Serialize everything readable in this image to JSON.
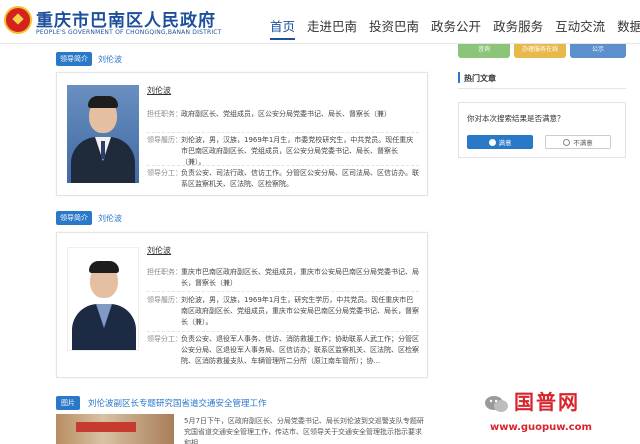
{
  "header": {
    "site_title": "重庆市巴南区人民政府",
    "site_subtitle": "PEOPLE'S GOVERNMENT OF CHONGQING,BANAN DISTRICT",
    "nav": [
      "首页",
      "走进巴南",
      "投资巴南",
      "政务公开",
      "政务服务",
      "互动交流",
      "数据发布"
    ],
    "active_nav_index": 0
  },
  "leaders": [
    {
      "tag": "领导简介",
      "name": "刘伦波",
      "fields": [
        {
          "label": "担任职务：",
          "value": "政府副区长、党组成员，区公安分局党委书记、局长、督察长（兼）"
        },
        {
          "label": "领导履历：",
          "value": "刘伦波，男，汉族，1969年1月生，市委党校研究生，中共党员。现任重庆市巴南区政府副区长、党组成员，区公安分局党委书记、局长、督察长（兼）。"
        },
        {
          "label": "领导分工：",
          "value": "负责公安、司法行政、信访工作。分管区公安分局、区司法局、区信访办。联系区监察机关、区法院、区检察院。"
        }
      ]
    },
    {
      "tag": "领导简介",
      "name": "刘伦波",
      "fields": [
        {
          "label": "担任职务：",
          "value": "重庆市巴南区政府副区长、党组成员，重庆市公安局巴南区分局党委书记、局长，督察长（兼）"
        },
        {
          "label": "领导履历：",
          "value": "刘伦波，男，汉族，1969年1月生，研究生学历，中共党员。现任重庆市巴南区政府副区长、党组成员，重庆市公安局巴南区分局党委书记、局长，督察长（兼）。"
        },
        {
          "label": "领导分工：",
          "value": "负责公安、退役军人事务、信访、消防救援工作；协助联系人武工作；分管区公安分局、区退役军人事务局、区信访办；联系区监察机关、区法院、区检察院、区消防救援支队、车辆管理所二分所（原江南车管所）；协..."
        }
      ]
    }
  ],
  "news": {
    "tag": "图片",
    "title": "刘伦波副区长专题研究国省道交通安全管理工作",
    "excerpt": "5月7日下午，区政府副区长、分局党委书记、局长刘伦波到交巡警支队专题研究国省道交通安全管理工作，传达市、区领导关于交通安全管理批示指示要求和相"
  },
  "sidebar": {
    "quick_buttons": [
      {
        "label": "咨询",
        "color": "#8cc47a"
      },
      {
        "label": "办理服务在线",
        "color": "#e8b94a"
      },
      {
        "label": "公示",
        "color": "#5d8fcc"
      }
    ],
    "hot_title": "热门文章",
    "survey": {
      "question": "你对本次搜索结果是否满意？",
      "yes_label": "满意",
      "no_label": "不满意"
    }
  },
  "watermark": {
    "logo": "国普网",
    "url": "www.guopuw.com"
  }
}
